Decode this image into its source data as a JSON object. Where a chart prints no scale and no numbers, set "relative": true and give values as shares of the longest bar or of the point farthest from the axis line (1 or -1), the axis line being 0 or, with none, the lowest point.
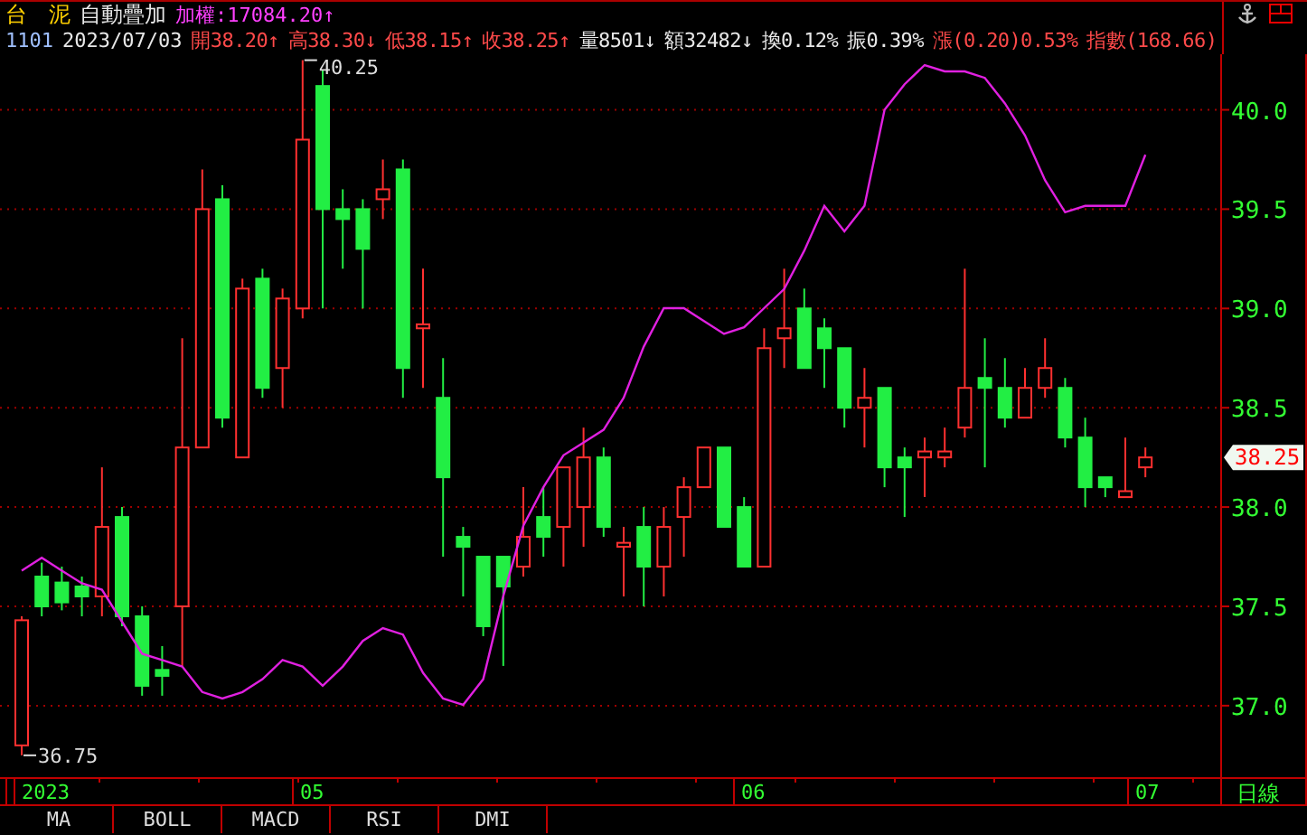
{
  "header": {
    "name": "台　泥",
    "mode": "自動疊加",
    "index_quote": "加權:17084.20↑",
    "code": "1101",
    "date": "2023/07/03",
    "quotes": [
      {
        "text": "開38.20↑",
        "color": "#ff4a4a"
      },
      {
        "text": "高38.30↓",
        "color": "#ff4a4a"
      },
      {
        "text": "低38.15↑",
        "color": "#ff4a4a"
      },
      {
        "text": "收38.25↑",
        "color": "#ff4a4a"
      },
      {
        "text": "量8501↓",
        "color": "#e8e8e8"
      },
      {
        "text": "額32482↓",
        "color": "#e8e8e8"
      },
      {
        "text": "換0.12%",
        "color": "#e8e8e8"
      },
      {
        "text": "振0.39%",
        "color": "#e8e8e8"
      },
      {
        "text": "漲(0.20)0.53%",
        "color": "#ff4a4a"
      },
      {
        "text": "指數(168.66)",
        "color": "#ff4a4a"
      }
    ]
  },
  "chart": {
    "last_price": "38.25",
    "period": "日線",
    "date_axis_labels": [
      "2023",
      "05",
      "06",
      "07"
    ],
    "chart_data": {
      "type": "candlestick",
      "grid": true,
      "ylim": [
        36.64,
        40.28
      ],
      "yticks": [
        {
          "value": 40,
          "label": "40.0"
        },
        {
          "value": 39.5,
          "label": "39.5"
        },
        {
          "value": 39,
          "label": "39.0"
        },
        {
          "value": 38.5,
          "label": "38.5"
        },
        {
          "value": 38,
          "label": "38.0"
        },
        {
          "value": 37.5,
          "label": "37.5"
        },
        {
          "value": 37,
          "label": "37.0"
        }
      ],
      "ohlc": [
        [
          36.8,
          37.45,
          36.75,
          37.43
        ],
        [
          37.65,
          37.72,
          37.45,
          37.5
        ],
        [
          37.62,
          37.7,
          37.48,
          37.52
        ],
        [
          37.6,
          37.65,
          37.45,
          37.55
        ],
        [
          37.55,
          38.2,
          37.45,
          37.9
        ],
        [
          37.95,
          38,
          37.4,
          37.45
        ],
        [
          37.45,
          37.5,
          37.05,
          37.1
        ],
        [
          37.18,
          37.3,
          37.05,
          37.15
        ],
        [
          37.5,
          38.85,
          37.2,
          38.3
        ],
        [
          38.3,
          39.7,
          38.3,
          39.5
        ],
        [
          39.55,
          39.62,
          38.4,
          38.45
        ],
        [
          38.25,
          39.15,
          38.25,
          39.1
        ],
        [
          39.15,
          39.2,
          38.55,
          38.6
        ],
        [
          38.7,
          39.1,
          38.5,
          39.05
        ],
        [
          39,
          40.25,
          38.95,
          39.85
        ],
        [
          40.12,
          40.2,
          39,
          39.5
        ],
        [
          39.5,
          39.6,
          39.2,
          39.45
        ],
        [
          39.5,
          39.55,
          39,
          39.3
        ],
        [
          39.55,
          39.75,
          39.45,
          39.6
        ],
        [
          39.7,
          39.75,
          38.55,
          38.7
        ],
        [
          38.9,
          39.2,
          38.6,
          38.92
        ],
        [
          38.55,
          38.75,
          37.75,
          38.15
        ],
        [
          37.85,
          37.9,
          37.55,
          37.8
        ],
        [
          37.75,
          37.75,
          37.35,
          37.4
        ],
        [
          37.75,
          37.75,
          37.2,
          37.6
        ],
        [
          37.7,
          38.1,
          37.65,
          37.85
        ],
        [
          37.95,
          38.1,
          37.75,
          37.85
        ],
        [
          37.9,
          38.2,
          37.7,
          38.2
        ],
        [
          38,
          38.4,
          37.8,
          38.25
        ],
        [
          38.25,
          38.3,
          37.85,
          37.9
        ],
        [
          37.8,
          37.9,
          37.55,
          37.82
        ],
        [
          37.9,
          38,
          37.5,
          37.7
        ],
        [
          37.7,
          38,
          37.55,
          37.9
        ],
        [
          37.95,
          38.15,
          37.75,
          38.1
        ],
        [
          38.1,
          38.3,
          38.1,
          38.3
        ],
        [
          38.3,
          38.3,
          37.9,
          37.9
        ],
        [
          38,
          38.05,
          37.7,
          37.7
        ],
        [
          37.7,
          38.9,
          37.7,
          38.8
        ],
        [
          38.85,
          39.2,
          38.7,
          38.9
        ],
        [
          39,
          39.1,
          38.7,
          38.7
        ],
        [
          38.9,
          38.95,
          38.6,
          38.8
        ],
        [
          38.8,
          38.8,
          38.4,
          38.5
        ],
        [
          38.5,
          38.7,
          38.3,
          38.55
        ],
        [
          38.6,
          38.6,
          38.1,
          38.2
        ],
        [
          38.25,
          38.3,
          37.95,
          38.2
        ],
        [
          38.25,
          38.35,
          38.05,
          38.28
        ],
        [
          38.25,
          38.4,
          38.2,
          38.28
        ],
        [
          38.4,
          39.2,
          38.35,
          38.6
        ],
        [
          38.65,
          38.85,
          38.2,
          38.6
        ],
        [
          38.6,
          38.75,
          38.4,
          38.45
        ],
        [
          38.45,
          38.7,
          38.45,
          38.6
        ],
        [
          38.6,
          38.85,
          38.55,
          38.7
        ],
        [
          38.6,
          38.65,
          38.3,
          38.35
        ],
        [
          38.35,
          38.45,
          38,
          38.1
        ],
        [
          38.15,
          38.15,
          38.05,
          38.1
        ],
        [
          38.05,
          38.35,
          38.05,
          38.08
        ],
        [
          38.2,
          38.3,
          38.15,
          38.25
        ]
      ],
      "annotations": [
        "40.25",
        "36.75"
      ]
    },
    "overlay": {
      "chart_data": {
        "type": "line",
        "relative": true,
        "series": [
          {
            "color": "#e020e0",
            "values": [
              0.21,
              0.23,
              0.21,
              0.19,
              0.18,
              0.13,
              0.08,
              0.07,
              0.06,
              0.02,
              0.01,
              0.02,
              0.04,
              0.07,
              0.06,
              0.03,
              0.06,
              0.1,
              0.12,
              0.11,
              0.05,
              0.01,
              0,
              0.04,
              0.17,
              0.28,
              0.34,
              0.39,
              0.41,
              0.43,
              0.48,
              0.56,
              0.62,
              0.62,
              0.6,
              0.58,
              0.59,
              0.62,
              0.65,
              0.71,
              0.78,
              0.74,
              0.78,
              0.93,
              0.97,
              1,
              0.99,
              0.99,
              0.98,
              0.94,
              0.89,
              0.82,
              0.77,
              0.78,
              0.78,
              0.78,
              0.86
            ]
          }
        ]
      }
    }
  },
  "indicator_tabs": [
    "MA",
    "BOLL",
    "MACD",
    "RSI",
    "DMI"
  ]
}
